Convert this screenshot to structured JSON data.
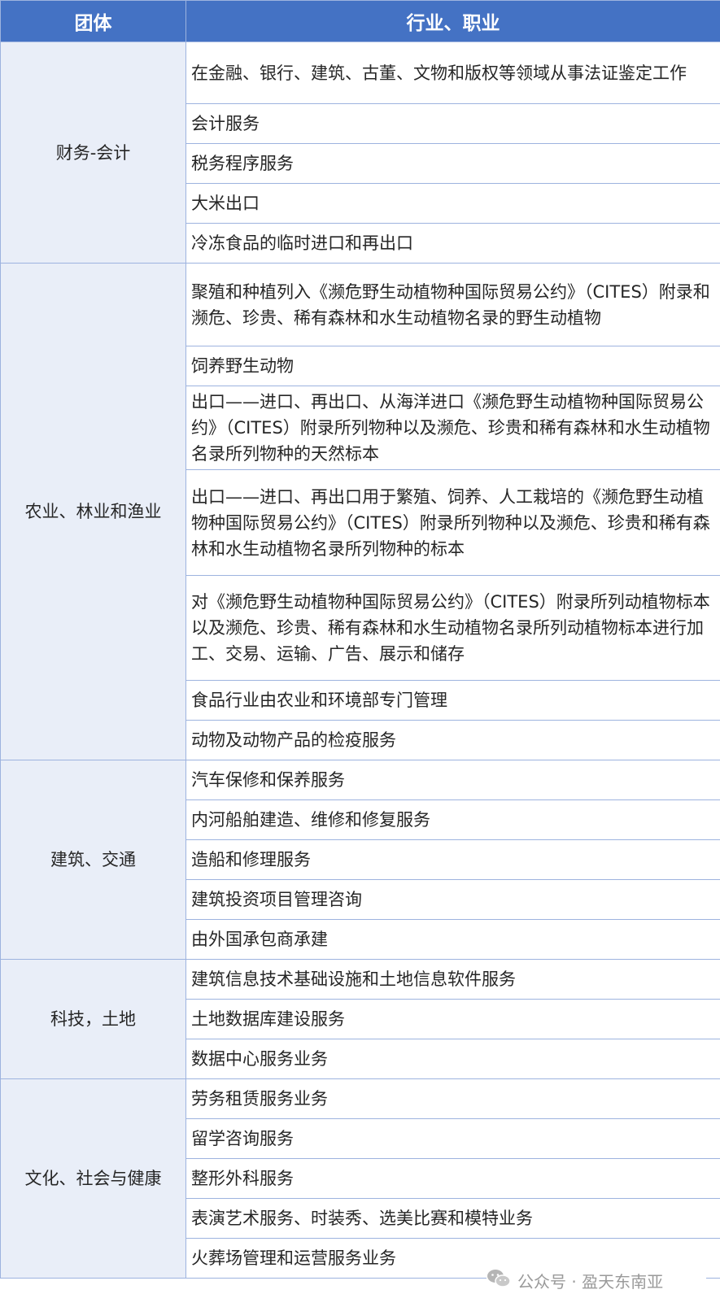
{
  "header": {
    "col1": "团体",
    "col2": "行业、职业"
  },
  "groups": [
    {
      "name": "财务-会计",
      "items": [
        "在金融、银行、建筑、古董、文物和版权等领域从事法证鉴定工作",
        "会计服务",
        "税务程序服务",
        "大米出口",
        "冷冻食品的临时进口和再出口"
      ]
    },
    {
      "name": "农业、林业和渔业",
      "items": [
        "聚殖和种植列入《濒危野生动植物种国际贸易公约》（CITES）附录和濒危、珍贵、稀有森林和水生动植物名录的野生动植物",
        "饲养野生动物",
        "出口——进口、再出口、从海洋进口《濒危野生动植物种国际贸易公约》（CITES）附录所列物种以及濒危、珍贵和稀有森林和水生动植物名录所列物种的天然标本",
        "出口——进口、再出口用于繁殖、饲养、人工栽培的《濒危野生动植物种国际贸易公约》（CITES）附录所列物种以及濒危、珍贵和稀有森林和水生动植物名录所列物种的标本",
        "对《濒危野生动植物种国际贸易公约》（CITES）附录所列动植物标本以及濒危、珍贵、稀有森林和水生动植物名录所列动植物标本进行加工、交易、运输、广告、展示和储存",
        "食品行业由农业和环境部专门管理",
        "动物及动物产品的检疫服务"
      ]
    },
    {
      "name": "建筑、交通",
      "items": [
        "汽车保修和保养服务",
        "内河船舶建造、维修和修复服务",
        "造船和修理服务",
        "建筑投资项目管理咨询",
        "由外国承包商承建"
      ]
    },
    {
      "name": "科技，土地",
      "items": [
        "建筑信息技术基础设施和土地信息软件服务",
        "土地数据库建设服务",
        "数据中心服务业务"
      ]
    },
    {
      "name": "文化、社会与健康",
      "items": [
        "劳务租赁服务业务",
        "留学咨询服务",
        "整形外科服务",
        "表演艺术服务、时装秀、选美比赛和模特业务",
        "火葬场管理和运营服务业务"
      ]
    }
  ],
  "watermark": {
    "text": "公众号 · 盈天东南亚",
    "icon": "wechat-icon"
  }
}
